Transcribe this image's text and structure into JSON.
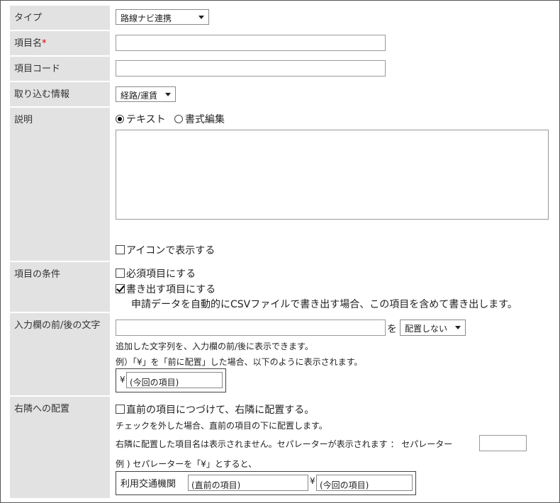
{
  "fields": {
    "type": {
      "label": "タイプ",
      "value": "路線ナビ連携"
    },
    "item_name": {
      "label": "項目名",
      "required_mark": "*"
    },
    "item_code": {
      "label": "項目コード"
    },
    "import_info": {
      "label": "取り込む情報",
      "value": "経路/運賃"
    },
    "description": {
      "label": "説明",
      "radio_text": "テキスト",
      "radio_rich": "書式編集",
      "selected": "テキスト",
      "icon_checkbox_label": "アイコンで表示する",
      "icon_checked": false
    },
    "conditions": {
      "label": "項目の条件",
      "required_label": "必須項目にする",
      "required_checked": false,
      "export_label": "書き出す項目にする",
      "export_checked": true,
      "export_note": "申請データを自動的にCSVファイルで書き出す場合、この項目を含めて書き出します。"
    },
    "surrounding_text": {
      "label": "入力欄の前/後の文字",
      "particle": "を",
      "placement_value": "配置しない",
      "note1": "追加した文字列を、入力欄の前/後に表示できます。",
      "note2": "例）「¥」を「前に配置」した場合、以下のように表示されます。",
      "example_prefix": "¥",
      "example_value": "(今回の項目)"
    },
    "right_placement": {
      "label": "右隣への配置",
      "checkbox_label": "直前の項目につづけて、右隣に配置する。",
      "checked": false,
      "note1": "チェックを外した場合、直前の項目の下に配置します。",
      "note2": "右隣に配置した項目名は表示されません。セパレーターが表示されます ： セパレーター",
      "note3": "例 ) セパレーターを「¥」とすると、",
      "example_label": "利用交通機関",
      "example_prev": "(直前の項目)",
      "example_sep": "¥",
      "example_current": "(今回の項目)"
    }
  }
}
